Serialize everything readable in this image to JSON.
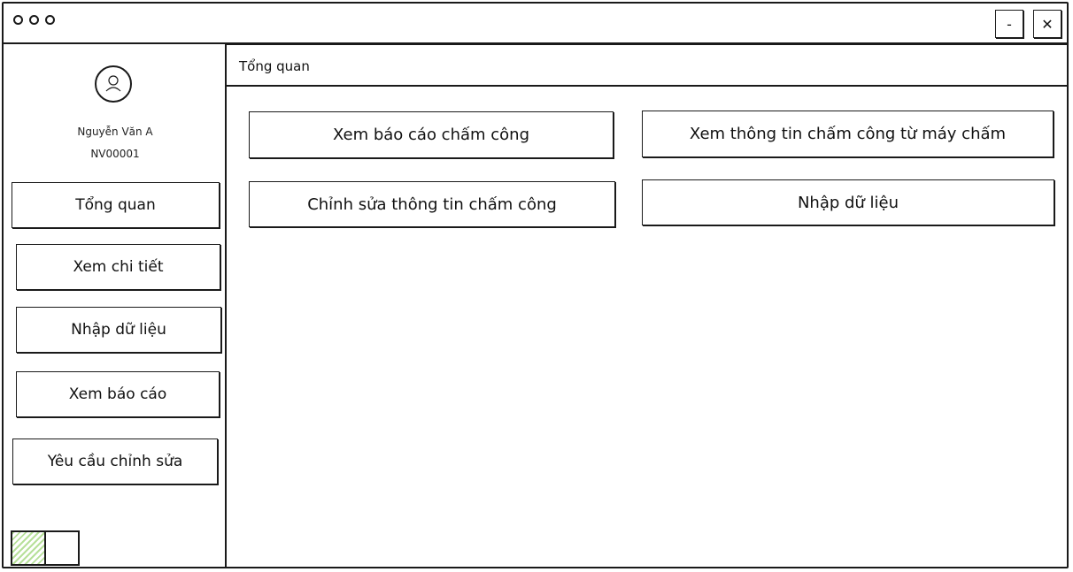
{
  "window": {
    "traffic_lights": [
      "circle-icon",
      "circle-icon",
      "circle-icon"
    ],
    "minimize_label": "-",
    "close_label": "✕"
  },
  "user": {
    "avatar_icon": "user-icon",
    "name": "Nguyễn Văn A",
    "id": "NV00001"
  },
  "sidebar": {
    "items": [
      {
        "label": "Tổng quan"
      },
      {
        "label": "Xem chi tiết"
      },
      {
        "label": "Nhập dữ liệu"
      },
      {
        "label": "Xem báo cáo"
      },
      {
        "label": "Yêu cầu chỉnh sửa"
      }
    ],
    "toggle": {
      "state": "on",
      "accent": "#b7e09a"
    }
  },
  "header": {
    "breadcrumb": "Tổng quan"
  },
  "main": {
    "actions": [
      {
        "label": "Xem báo cáo chấm công"
      },
      {
        "label": "Xem thông tin chấm công từ máy chấm"
      },
      {
        "label": "Chỉnh sửa thông tin chấm công"
      },
      {
        "label": "Nhập dữ liệu"
      }
    ]
  }
}
